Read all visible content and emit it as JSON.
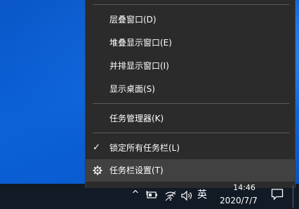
{
  "context_menu": {
    "items": [
      {
        "label": "层叠窗口(D)"
      },
      {
        "label": "堆叠显示窗口(E)"
      },
      {
        "label": "并排显示窗口(I)"
      },
      {
        "label": "显示桌面(S)"
      },
      {
        "label": "任务管理器(K)"
      },
      {
        "label": "锁定所有任务栏(L)",
        "checked": true,
        "check_glyph": "✓"
      },
      {
        "label": "任务栏设置(T)",
        "icon": "gear-icon",
        "hovered": true
      }
    ]
  },
  "tray": {
    "show_hidden_glyph": "^",
    "battery_icon": "battery-icon",
    "network_icon": "wifi-icon",
    "volume_icon": "speaker-icon",
    "input_method": "英",
    "time": "14:46",
    "date": "2020/7/7",
    "notification_icon": "notification-icon"
  },
  "colors": {
    "desktop_blue": "#0b62d6",
    "menu_bg": "#2b2b2b",
    "menu_hover": "#414141",
    "separator": "#5a5a5a",
    "taskbar": "#121a26"
  }
}
